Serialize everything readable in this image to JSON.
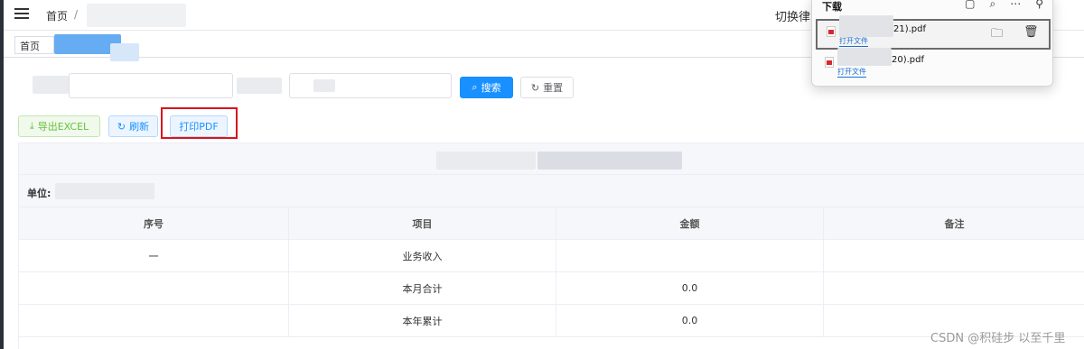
{
  "header": {
    "breadcrumb_home": "首页",
    "breadcrumb_sep": "/",
    "switch_text": "切换律"
  },
  "tabs": {
    "first_tab": "首页"
  },
  "search": {
    "search_label": "搜索",
    "reset_label": "重置"
  },
  "toolbar": {
    "export_label": "导出EXCEL",
    "refresh_label": "刷新",
    "print_label": "打印PDF"
  },
  "table": {
    "unit_label": "单位:",
    "columns": [
      "序号",
      "项目",
      "金额",
      "备注"
    ],
    "rows": [
      {
        "index": "一",
        "item": "业务收入",
        "amount": "",
        "note": ""
      },
      {
        "index": "",
        "item": "本月合计",
        "amount": "0.0",
        "note": ""
      },
      {
        "index": "",
        "item": "本年累计",
        "amount": "0.0",
        "note": ""
      }
    ]
  },
  "downloads": {
    "title": "下载",
    "items": [
      {
        "name_suffix": "21).pdf",
        "open_label": "打开文件"
      },
      {
        "name_suffix": "20).pdf",
        "open_label": "打开文件"
      }
    ]
  },
  "watermark": "CSDN @积硅步 以至千里"
}
